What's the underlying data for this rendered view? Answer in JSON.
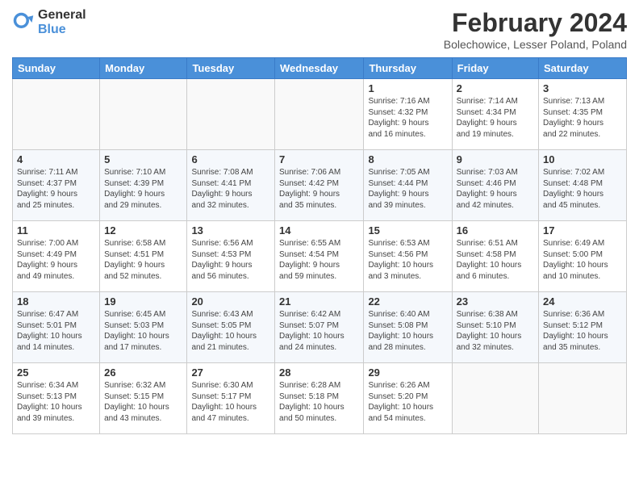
{
  "header": {
    "logo_general": "General",
    "logo_blue": "Blue",
    "title": "February 2024",
    "subtitle": "Bolechowice, Lesser Poland, Poland"
  },
  "weekdays": [
    "Sunday",
    "Monday",
    "Tuesday",
    "Wednesday",
    "Thursday",
    "Friday",
    "Saturday"
  ],
  "weeks": [
    [
      {
        "day": "",
        "info": ""
      },
      {
        "day": "",
        "info": ""
      },
      {
        "day": "",
        "info": ""
      },
      {
        "day": "",
        "info": ""
      },
      {
        "day": "1",
        "info": "Sunrise: 7:16 AM\nSunset: 4:32 PM\nDaylight: 9 hours\nand 16 minutes."
      },
      {
        "day": "2",
        "info": "Sunrise: 7:14 AM\nSunset: 4:34 PM\nDaylight: 9 hours\nand 19 minutes."
      },
      {
        "day": "3",
        "info": "Sunrise: 7:13 AM\nSunset: 4:35 PM\nDaylight: 9 hours\nand 22 minutes."
      }
    ],
    [
      {
        "day": "4",
        "info": "Sunrise: 7:11 AM\nSunset: 4:37 PM\nDaylight: 9 hours\nand 25 minutes."
      },
      {
        "day": "5",
        "info": "Sunrise: 7:10 AM\nSunset: 4:39 PM\nDaylight: 9 hours\nand 29 minutes."
      },
      {
        "day": "6",
        "info": "Sunrise: 7:08 AM\nSunset: 4:41 PM\nDaylight: 9 hours\nand 32 minutes."
      },
      {
        "day": "7",
        "info": "Sunrise: 7:06 AM\nSunset: 4:42 PM\nDaylight: 9 hours\nand 35 minutes."
      },
      {
        "day": "8",
        "info": "Sunrise: 7:05 AM\nSunset: 4:44 PM\nDaylight: 9 hours\nand 39 minutes."
      },
      {
        "day": "9",
        "info": "Sunrise: 7:03 AM\nSunset: 4:46 PM\nDaylight: 9 hours\nand 42 minutes."
      },
      {
        "day": "10",
        "info": "Sunrise: 7:02 AM\nSunset: 4:48 PM\nDaylight: 9 hours\nand 45 minutes."
      }
    ],
    [
      {
        "day": "11",
        "info": "Sunrise: 7:00 AM\nSunset: 4:49 PM\nDaylight: 9 hours\nand 49 minutes."
      },
      {
        "day": "12",
        "info": "Sunrise: 6:58 AM\nSunset: 4:51 PM\nDaylight: 9 hours\nand 52 minutes."
      },
      {
        "day": "13",
        "info": "Sunrise: 6:56 AM\nSunset: 4:53 PM\nDaylight: 9 hours\nand 56 minutes."
      },
      {
        "day": "14",
        "info": "Sunrise: 6:55 AM\nSunset: 4:54 PM\nDaylight: 9 hours\nand 59 minutes."
      },
      {
        "day": "15",
        "info": "Sunrise: 6:53 AM\nSunset: 4:56 PM\nDaylight: 10 hours\nand 3 minutes."
      },
      {
        "day": "16",
        "info": "Sunrise: 6:51 AM\nSunset: 4:58 PM\nDaylight: 10 hours\nand 6 minutes."
      },
      {
        "day": "17",
        "info": "Sunrise: 6:49 AM\nSunset: 5:00 PM\nDaylight: 10 hours\nand 10 minutes."
      }
    ],
    [
      {
        "day": "18",
        "info": "Sunrise: 6:47 AM\nSunset: 5:01 PM\nDaylight: 10 hours\nand 14 minutes."
      },
      {
        "day": "19",
        "info": "Sunrise: 6:45 AM\nSunset: 5:03 PM\nDaylight: 10 hours\nand 17 minutes."
      },
      {
        "day": "20",
        "info": "Sunrise: 6:43 AM\nSunset: 5:05 PM\nDaylight: 10 hours\nand 21 minutes."
      },
      {
        "day": "21",
        "info": "Sunrise: 6:42 AM\nSunset: 5:07 PM\nDaylight: 10 hours\nand 24 minutes."
      },
      {
        "day": "22",
        "info": "Sunrise: 6:40 AM\nSunset: 5:08 PM\nDaylight: 10 hours\nand 28 minutes."
      },
      {
        "day": "23",
        "info": "Sunrise: 6:38 AM\nSunset: 5:10 PM\nDaylight: 10 hours\nand 32 minutes."
      },
      {
        "day": "24",
        "info": "Sunrise: 6:36 AM\nSunset: 5:12 PM\nDaylight: 10 hours\nand 35 minutes."
      }
    ],
    [
      {
        "day": "25",
        "info": "Sunrise: 6:34 AM\nSunset: 5:13 PM\nDaylight: 10 hours\nand 39 minutes."
      },
      {
        "day": "26",
        "info": "Sunrise: 6:32 AM\nSunset: 5:15 PM\nDaylight: 10 hours\nand 43 minutes."
      },
      {
        "day": "27",
        "info": "Sunrise: 6:30 AM\nSunset: 5:17 PM\nDaylight: 10 hours\nand 47 minutes."
      },
      {
        "day": "28",
        "info": "Sunrise: 6:28 AM\nSunset: 5:18 PM\nDaylight: 10 hours\nand 50 minutes."
      },
      {
        "day": "29",
        "info": "Sunrise: 6:26 AM\nSunset: 5:20 PM\nDaylight: 10 hours\nand 54 minutes."
      },
      {
        "day": "",
        "info": ""
      },
      {
        "day": "",
        "info": ""
      }
    ]
  ]
}
